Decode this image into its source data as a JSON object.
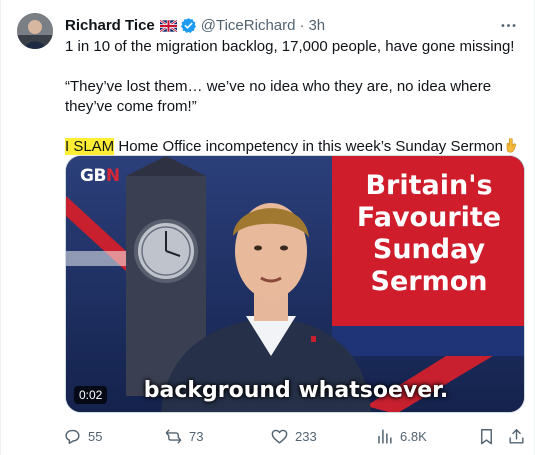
{
  "author": {
    "display_name": "Richard Tice",
    "handle": "@TiceRichard",
    "separator": "·",
    "timestamp": "3h"
  },
  "tweet": {
    "line1": "1 in 10 of the migration backlog, 17,000 people, have gone missing!",
    "line2": "“They’ve lost them… we’ve no idea who they are, no idea where they’ve come from!”",
    "line3_highlight": "I SLAM",
    "line3_rest": " Home Office incompetency in this week’s Sunday Sermon"
  },
  "media": {
    "channel_logo_a": "GB",
    "channel_logo_b": "N",
    "panel_lines": [
      "Britain's",
      "Favourite",
      "Sunday",
      "Sermon"
    ],
    "caption": "background whatsoever.",
    "duration": "0:02"
  },
  "actions": {
    "replies": "55",
    "reposts": "73",
    "likes": "233",
    "views": "6.8K"
  },
  "icons": [
    "flag-uk-icon",
    "verified-badge-icon",
    "more-icon",
    "pointing-down-emoji-icon",
    "reply-icon",
    "repost-icon",
    "like-icon",
    "views-icon",
    "bookmark-icon",
    "share-icon"
  ],
  "colors": {
    "text": "#0f1419",
    "muted": "#536471",
    "verified": "#1d9bf0",
    "highlight": "#ffee33",
    "panel_red": "#cf1d2b"
  }
}
